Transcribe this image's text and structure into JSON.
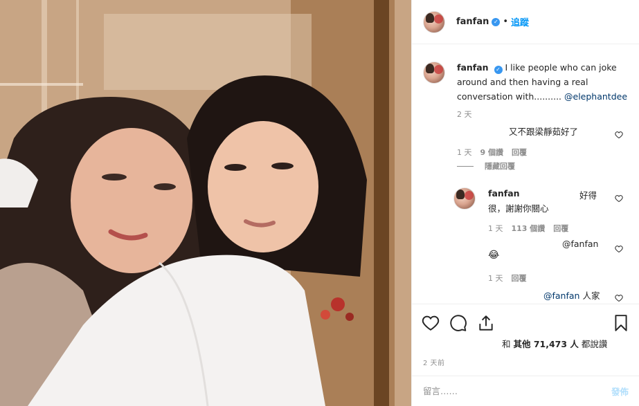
{
  "header": {
    "username": "fanfan",
    "separator": "•",
    "follow_label": "追蹤"
  },
  "caption": {
    "username": "fanfan",
    "text": "I like people who can joke around and then having a real conversation with.......... ",
    "mention": "@elephantdee",
    "time": "2 天"
  },
  "comments": [
    {
      "text": "又不跟梁靜茹好了",
      "time": "1 天",
      "likes": "9 個讚",
      "reply_label": "回覆"
    }
  ],
  "hide_replies_label": "隱藏回覆",
  "replies": [
    {
      "username": "fanfan",
      "text_right": "好得",
      "text_line2": "很，謝謝你關心",
      "time": "1 天",
      "likes": "113 個讚",
      "reply_label": "回覆"
    },
    {
      "mention": "@fanfan",
      "emoji": "😂",
      "time": "1 天",
      "reply_label": "回覆"
    },
    {
      "mention": "@fanfan",
      "text": " 人家"
    }
  ],
  "likes": {
    "prefix": "和 ",
    "others": "其他 71,473 人",
    "suffix": " 都說讚"
  },
  "post_time": "2 天前",
  "comment_box": {
    "placeholder": "留言……",
    "post_label": "發佈"
  },
  "colors": {
    "accent": "#0095f6",
    "verified": "#3897f0",
    "muted": "#8e8e8e",
    "post_disabled": "#b2dffc"
  },
  "icons": [
    "verified-badge-icon",
    "heart-icon",
    "comment-icon",
    "share-icon",
    "bookmark-icon"
  ]
}
